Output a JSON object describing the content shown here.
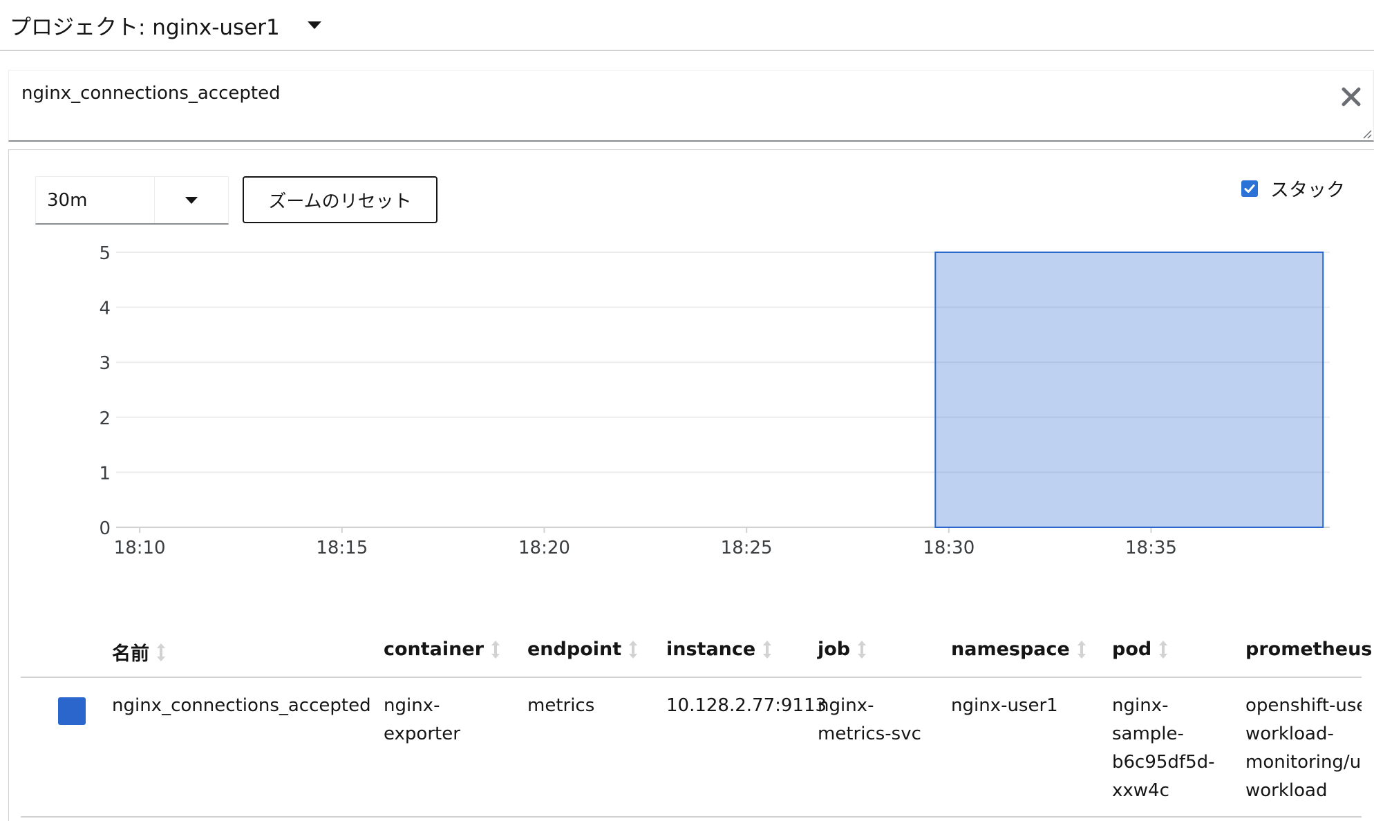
{
  "project": {
    "label": "プロジェクト: nginx-user1"
  },
  "query": {
    "text": "nginx_connections_accepted"
  },
  "toolbar": {
    "time_span": "30m",
    "zoom_reset_label": "ズームのリセット",
    "stack_label": "スタック",
    "stack_checked": true
  },
  "chart_data": {
    "type": "area",
    "stacked": true,
    "x_ticks": [
      "18:10",
      "18:15",
      "18:20",
      "18:25",
      "18:30",
      "18:35"
    ],
    "y_ticks": [
      0,
      1,
      2,
      3,
      4,
      5
    ],
    "ylim": [
      0,
      5
    ],
    "xlim": [
      "18:09:25",
      "18:39:25"
    ],
    "grid": true,
    "series": [
      {
        "color": "#2b66cc",
        "points": [
          {
            "x": "18:29:40",
            "y": 5
          },
          {
            "x": "18:39:15",
            "y": 5
          }
        ]
      }
    ]
  },
  "table": {
    "columns": [
      "名前",
      "container",
      "endpoint",
      "instance",
      "job",
      "namespace",
      "pod",
      "prometheus"
    ],
    "rows": [
      {
        "swatch_color": "#2b66cc",
        "name": "nginx_connections_accepted",
        "container": [
          "nginx-",
          "exporter"
        ],
        "endpoint": "metrics",
        "instance": "10.128.2.77:9113",
        "job": [
          "nginx-",
          "metrics-svc"
        ],
        "namespace": "nginx-user1",
        "pod": [
          "nginx-",
          "sample-",
          "b6c95df5d-",
          "xxw4c"
        ],
        "prometheus": [
          "openshift-user-",
          "workload-",
          "monitoring/user-",
          "workload"
        ]
      }
    ]
  }
}
